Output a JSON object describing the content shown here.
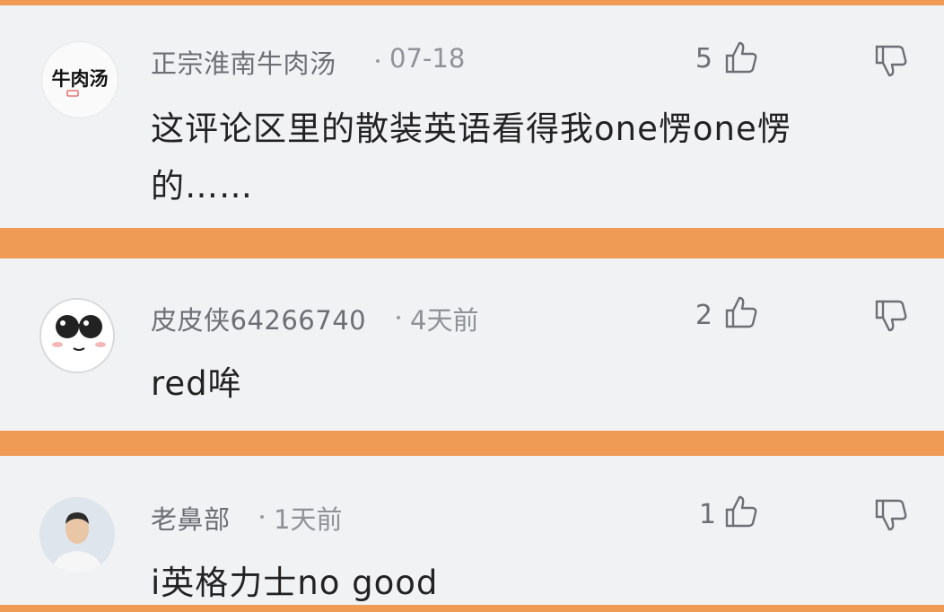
{
  "comments": [
    {
      "username": "正宗淮南牛肉汤",
      "time": "07-18",
      "likes": "5",
      "avatar_text": "牛肉汤",
      "text_line1": "这评论区里的散装英语看得我one愣one愣",
      "text_line2": "的……"
    },
    {
      "username": "皮皮侠64266740",
      "time": "4天前",
      "likes": "2",
      "text_line1": "red哞"
    },
    {
      "username": "老鼻部",
      "time": "1天前",
      "likes": "1",
      "text_line1": "i英格力士no good"
    }
  ],
  "icons": {
    "like": "thumbs-up-icon",
    "dislike": "thumbs-down-icon"
  },
  "colors": {
    "separator": "#ef9a55",
    "card_bg": "#f1f2f4",
    "username": "#6c6f74",
    "text": "#222222"
  }
}
